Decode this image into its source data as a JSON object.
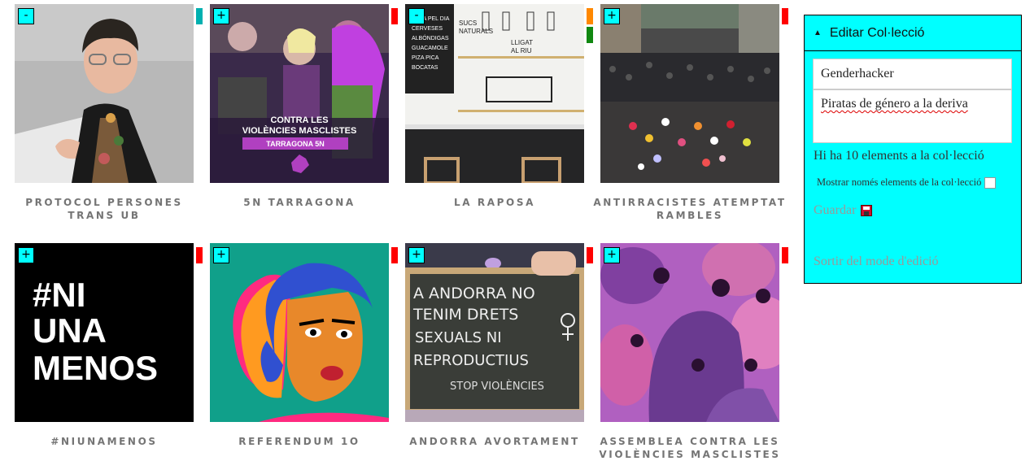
{
  "items": [
    {
      "title": "PROTOCOL PERSONES TRANS UB",
      "toggle": "-",
      "flags": [
        "#00b0b0"
      ]
    },
    {
      "title": "5N TARRAGONA",
      "toggle": "+",
      "flags": [
        "#ff0000"
      ],
      "image_text": {
        "line1": "CONTRA LES",
        "line2": "VIOLÈNCIES MASCLISTES",
        "line3": "TARRAGONA 5N"
      }
    },
    {
      "title": "LA RAPOSA",
      "toggle": "-",
      "flags": [
        "#ff8800",
        "#118811"
      ],
      "image_text": {
        "board1": "SUCS",
        "board2": "NATURALS",
        "board3": "LLIGAT",
        "board4": "AL RIU"
      }
    },
    {
      "title": "ANTIRRACISTES ATEMPTAT RAMBLES",
      "toggle": "+",
      "flags": [
        "#ff0000"
      ]
    },
    {
      "title": "#NIUNAMENOS",
      "toggle": "+",
      "flags": [
        "#ff0000"
      ],
      "image_text": {
        "line1": "#NI",
        "line2": "UNA",
        "line3": "MENOS"
      }
    },
    {
      "title": "REFERENDUM 1O",
      "toggle": "+",
      "flags": [
        "#ff0000"
      ]
    },
    {
      "title": "ANDORRA AVORTAMENT",
      "toggle": "+",
      "flags": [
        "#ff0000"
      ],
      "image_text": {
        "line1": "A ANDORRA NO",
        "line2": "TENIM DRETS",
        "line3": "SEXUALS NI",
        "line4": "REPRODUCTIUS",
        "line5": "STOP VIOLÈNCIES"
      }
    },
    {
      "title": "ASSEMBLEA CONTRA LES VIOLÈNCIES MASCLISTES",
      "toggle": "+",
      "flags": [
        "#ff0000"
      ]
    }
  ],
  "panel": {
    "header": "Editar Col·lecció",
    "title_value": "Genderhacker",
    "description_value": "Piratas de género a la deriva",
    "count_text": "Hi ha 10 elements a la col·lecció",
    "only_items_label": "Mostrar només elements de la col·lecció",
    "save_label": "Guardar",
    "exit_label": "Sortir del mode d'edició"
  },
  "colors": {
    "accent": "#00ffff",
    "caption": "#757575"
  }
}
